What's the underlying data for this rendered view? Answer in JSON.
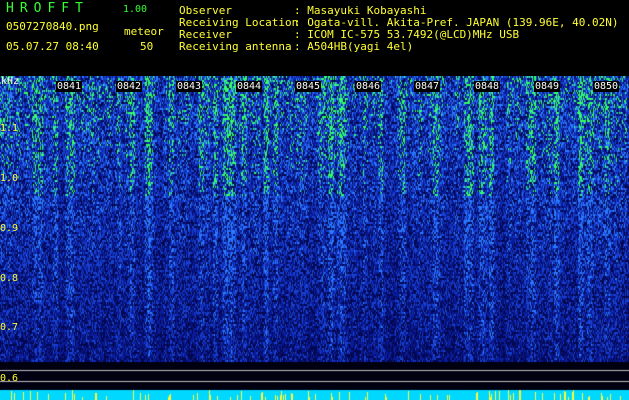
{
  "header": {
    "app_name": "HROFFT",
    "version": "1.00",
    "filename": "0507270840.png",
    "event_type": "meteor",
    "datetime": "05.07.27 08:40",
    "event_count": "50"
  },
  "station": [
    {
      "label": "Observer",
      "value": ": Masayuki Kobayashi"
    },
    {
      "label": "Receiving Location",
      "value": ": Ogata-vill. Akita-Pref. JAPAN (139.96E, 40.02N)"
    },
    {
      "label": "Receiver",
      "value": ": ICOM IC-575 53.7492(@LCD)MHz USB"
    },
    {
      "label": "Receiving antenna",
      "value": ": A504HB(yagi 4el)"
    }
  ],
  "spectrogram": {
    "unit": "kHz",
    "y_labels": [
      "1.1",
      "1.0",
      "0.9",
      "0.8",
      "0.7",
      "0.6"
    ],
    "time_labels": [
      "0841",
      "0842",
      "0843",
      "0844",
      "0845",
      "0846",
      "0847",
      "0848",
      "0849",
      "0850"
    ],
    "colors": {
      "background": "#000000",
      "noise_low": "#0000a0",
      "noise_high": "#2060ff",
      "signal": "#33ff66",
      "text_primary": "#33ff33",
      "text_secondary": "#ffff33",
      "baseline": "#00ffff"
    }
  }
}
